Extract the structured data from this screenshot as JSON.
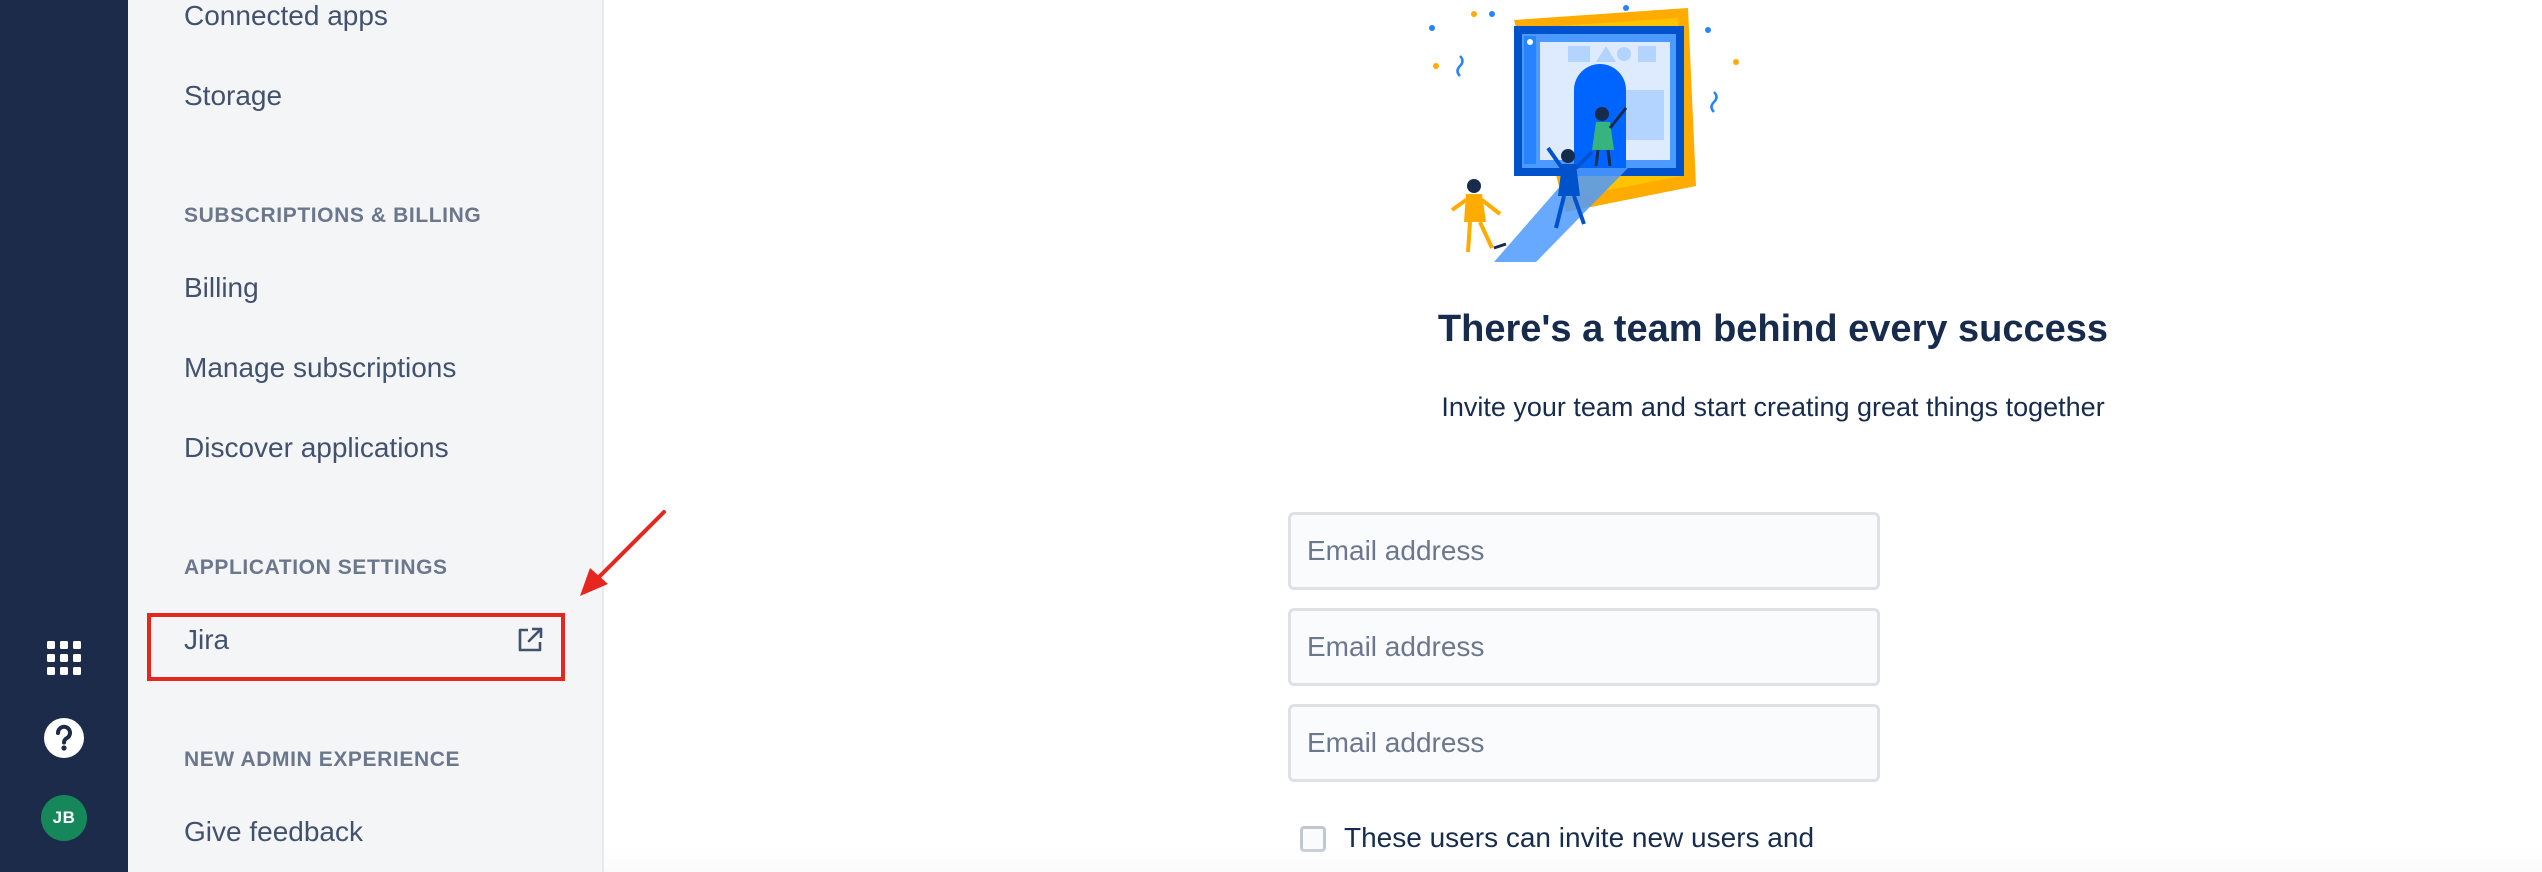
{
  "sidebar": {
    "items_top": [
      {
        "label": "Connected apps"
      },
      {
        "label": "Storage"
      }
    ],
    "subscriptions_heading": "SUBSCRIPTIONS & BILLING",
    "subscriptions_items": [
      {
        "label": "Billing"
      },
      {
        "label": "Manage subscriptions"
      },
      {
        "label": "Discover applications"
      }
    ],
    "app_settings_heading": "APPLICATION SETTINGS",
    "app_settings_items": [
      {
        "label": "Jira",
        "icon": "external-link-icon"
      }
    ],
    "new_admin_heading": "NEW ADMIN EXPERIENCE",
    "new_admin_items": [
      {
        "label": "Give feedback"
      }
    ]
  },
  "global_nav": {
    "icons": [
      "app-switcher-icon",
      "help-icon"
    ],
    "avatar_initials": "JB",
    "avatar_color": "#15875a",
    "background": "#1c2b4a"
  },
  "main": {
    "title": "There's a team behind every success",
    "subtitle": "Invite your team and start creating great things together",
    "email_placeholders": [
      "Email address",
      "Email address",
      "Email address"
    ],
    "checkbox_label": "These users can invite new users and"
  },
  "annotation": {
    "highlight_color": "#e5271f"
  }
}
